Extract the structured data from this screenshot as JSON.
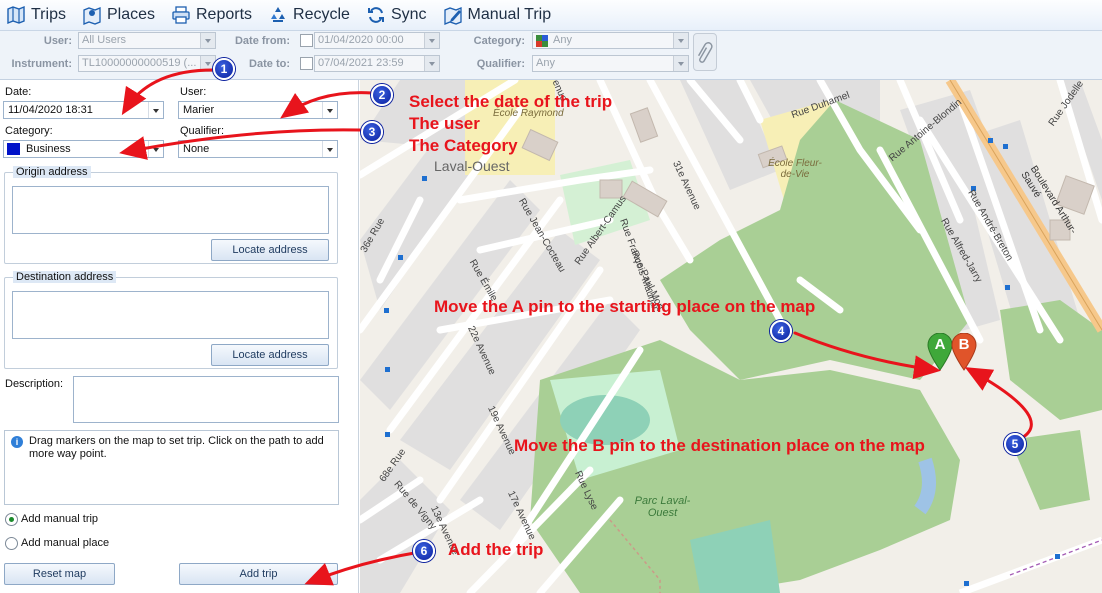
{
  "toolbar": {
    "items": [
      {
        "label": "Trips",
        "icon": "map-icon"
      },
      {
        "label": "Places",
        "icon": "places-icon"
      },
      {
        "label": "Reports",
        "icon": "printer-icon"
      },
      {
        "label": "Recycle",
        "icon": "recycle-icon"
      },
      {
        "label": "Sync",
        "icon": "sync-icon"
      },
      {
        "label": "Manual Trip",
        "icon": "manual-trip-icon"
      }
    ]
  },
  "filters": {
    "user_label": "User:",
    "user_value": "All Users",
    "instrument_label": "Instrument:",
    "instrument_value": "TL10000000000519 (...",
    "date_from_label": "Date from:",
    "date_from_value": "01/04/2020 00:00",
    "date_to_label": "Date to:",
    "date_to_value": "07/04/2021 23:59",
    "category_label": "Category:",
    "category_value": "Any",
    "qualifier_label": "Qualifier:",
    "qualifier_value": "Any"
  },
  "form": {
    "date_label": "Date:",
    "date_value": "11/04/2020 18:31",
    "user_label": "User:",
    "user_value": "Marier",
    "category_label": "Category:",
    "category_value": "Business",
    "qualifier_label": "Qualifier:",
    "qualifier_value": "None",
    "origin_title": "Origin address",
    "destination_title": "Destination address",
    "locate_label": "Locate address",
    "description_label": "Description:",
    "info_text": "Drag markers on the map to set trip. Click on the path to add more way point.",
    "radio_trip": "Add manual trip",
    "radio_place": "Add manual place",
    "reset_label": "Reset map",
    "add_label": "Add trip"
  },
  "map": {
    "places": [
      "Laval-Ouest",
      "École Raymond",
      "École Fleur-de-Vie",
      "Parc Laval-Ouest"
    ],
    "streets": [
      "Rue Jean-Cocteau",
      "Rue Albert-Camus",
      "Rue François-Mauriac",
      "Rue Émile",
      "Rue Paul-Mort",
      "31e Avenue",
      "Rue Duhamel",
      "Rue Antoine-Blondin",
      "Rue André-Breton",
      "Rue Alfred-Jarry",
      "Rue Jodelle",
      "Boulevard Arthur-Sauvé",
      "Rue Lyse",
      "36e Rue",
      "22e Avenue",
      "19e Avenue",
      "17e Avenue",
      "12e Avenue",
      "13e Avenue",
      "68e Rue",
      "Rue de Vigny",
      "Avenue",
      "se Avenue"
    ],
    "pin_a": "A",
    "pin_b": "B"
  },
  "annotations": {
    "n1": "1",
    "n2": "2",
    "n3": "3",
    "n4": "4",
    "n5": "5",
    "n6": "6",
    "step1_line1": "Select the date of the trip",
    "step1_line2": "The user",
    "step1_line3": "The Category",
    "step4": "Move the A pin to the starting place on the map",
    "step5": "Move the B pin to the destination place on the map",
    "step6": "Add the trip"
  },
  "colors": {
    "accent": "#e8141c",
    "category_swatch": "#0012c9"
  }
}
